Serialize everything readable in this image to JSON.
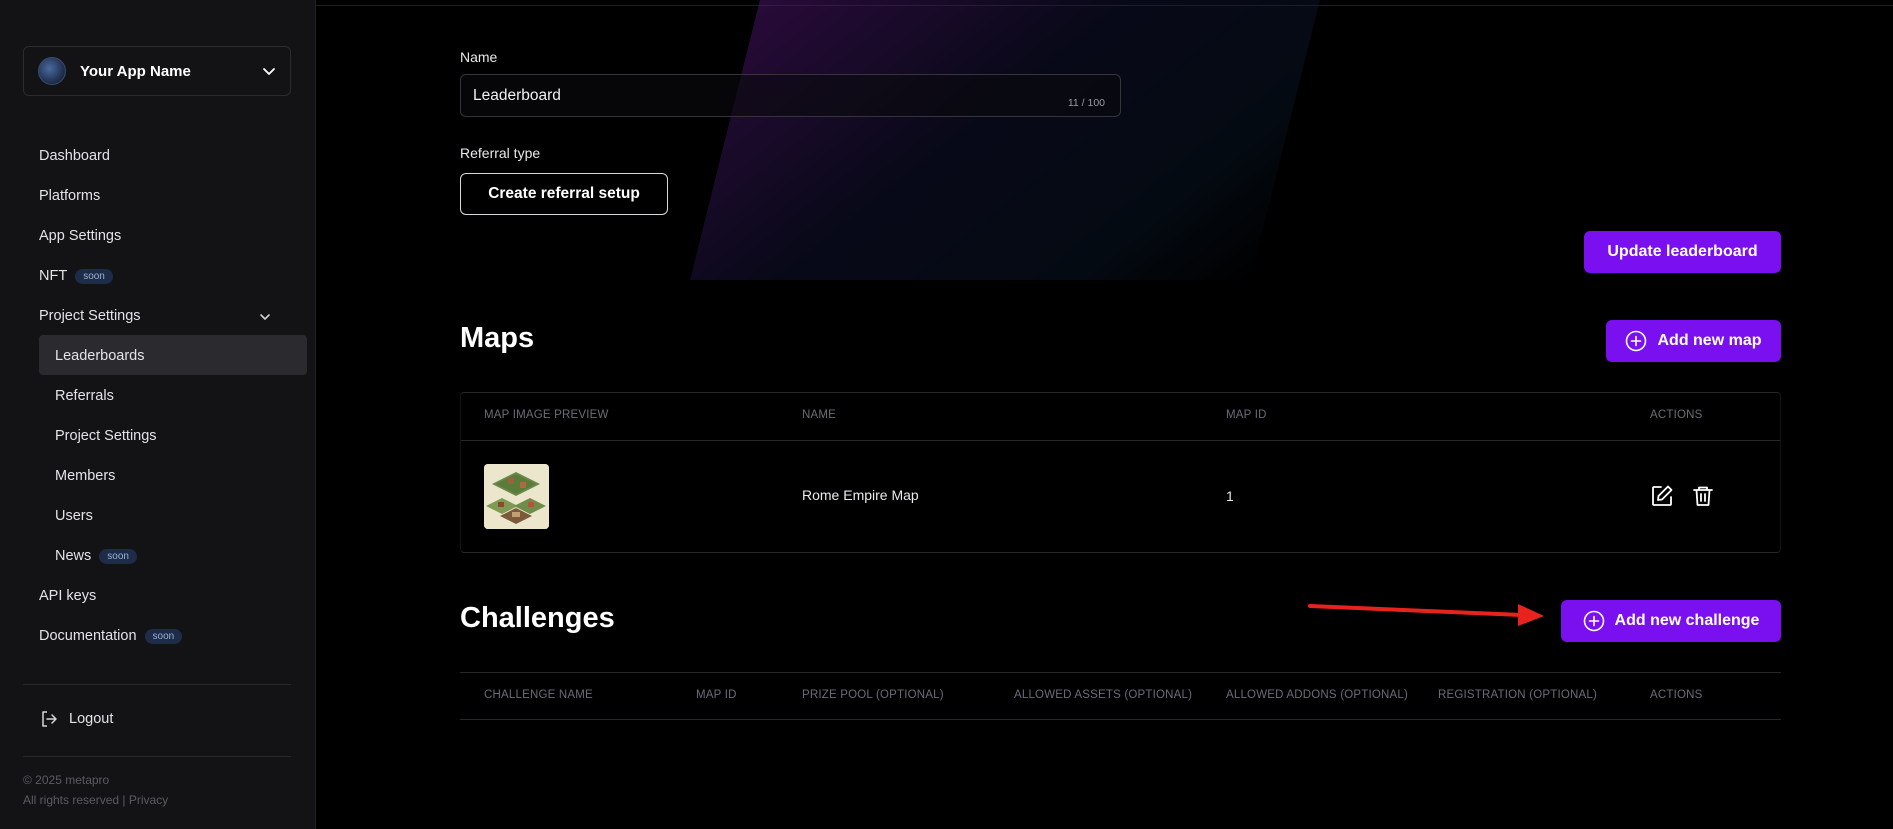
{
  "sidebar": {
    "app_name": "Your App Name",
    "items": [
      {
        "label": "Dashboard"
      },
      {
        "label": "Platforms"
      },
      {
        "label": "App Settings"
      },
      {
        "label": "NFT",
        "badge": "soon"
      },
      {
        "label": "Project Settings"
      },
      {
        "label": "Leaderboards"
      },
      {
        "label": "Referrals"
      },
      {
        "label": "Project Settings"
      },
      {
        "label": "Members"
      },
      {
        "label": "Users"
      },
      {
        "label": "News",
        "badge": "soon"
      },
      {
        "label": "API keys"
      },
      {
        "label": "Documentation",
        "badge": "soon"
      }
    ],
    "logout": "Logout",
    "footer_copyright": "© 2025 metapro",
    "footer_rights": "All rights reserved | Privacy"
  },
  "form": {
    "name_label": "Name",
    "name_value": "Leaderboard",
    "name_counter": "11 / 100",
    "referral_label": "Referral type",
    "referral_button": "Create referral setup",
    "update_button": "Update leaderboard"
  },
  "maps": {
    "title": "Maps",
    "add_button": "Add new map",
    "columns": [
      "MAP IMAGE PREVIEW",
      "NAME",
      "MAP ID",
      "ACTIONS"
    ],
    "rows": [
      {
        "name": "Rome Empire Map",
        "map_id": "1"
      }
    ]
  },
  "challenges": {
    "title": "Challenges",
    "add_button": "Add new challenge",
    "columns": [
      "CHALLENGE NAME",
      "MAP ID",
      "PRIZE POOL (OPTIONAL)",
      "ALLOWED ASSETS (OPTIONAL)",
      "ALLOWED ADDONS (OPTIONAL)",
      "REGISTRATION (OPTIONAL)",
      "ACTIONS"
    ]
  },
  "colors": {
    "accent": "#7a0ff0",
    "annotation_arrow": "#e8231e"
  }
}
